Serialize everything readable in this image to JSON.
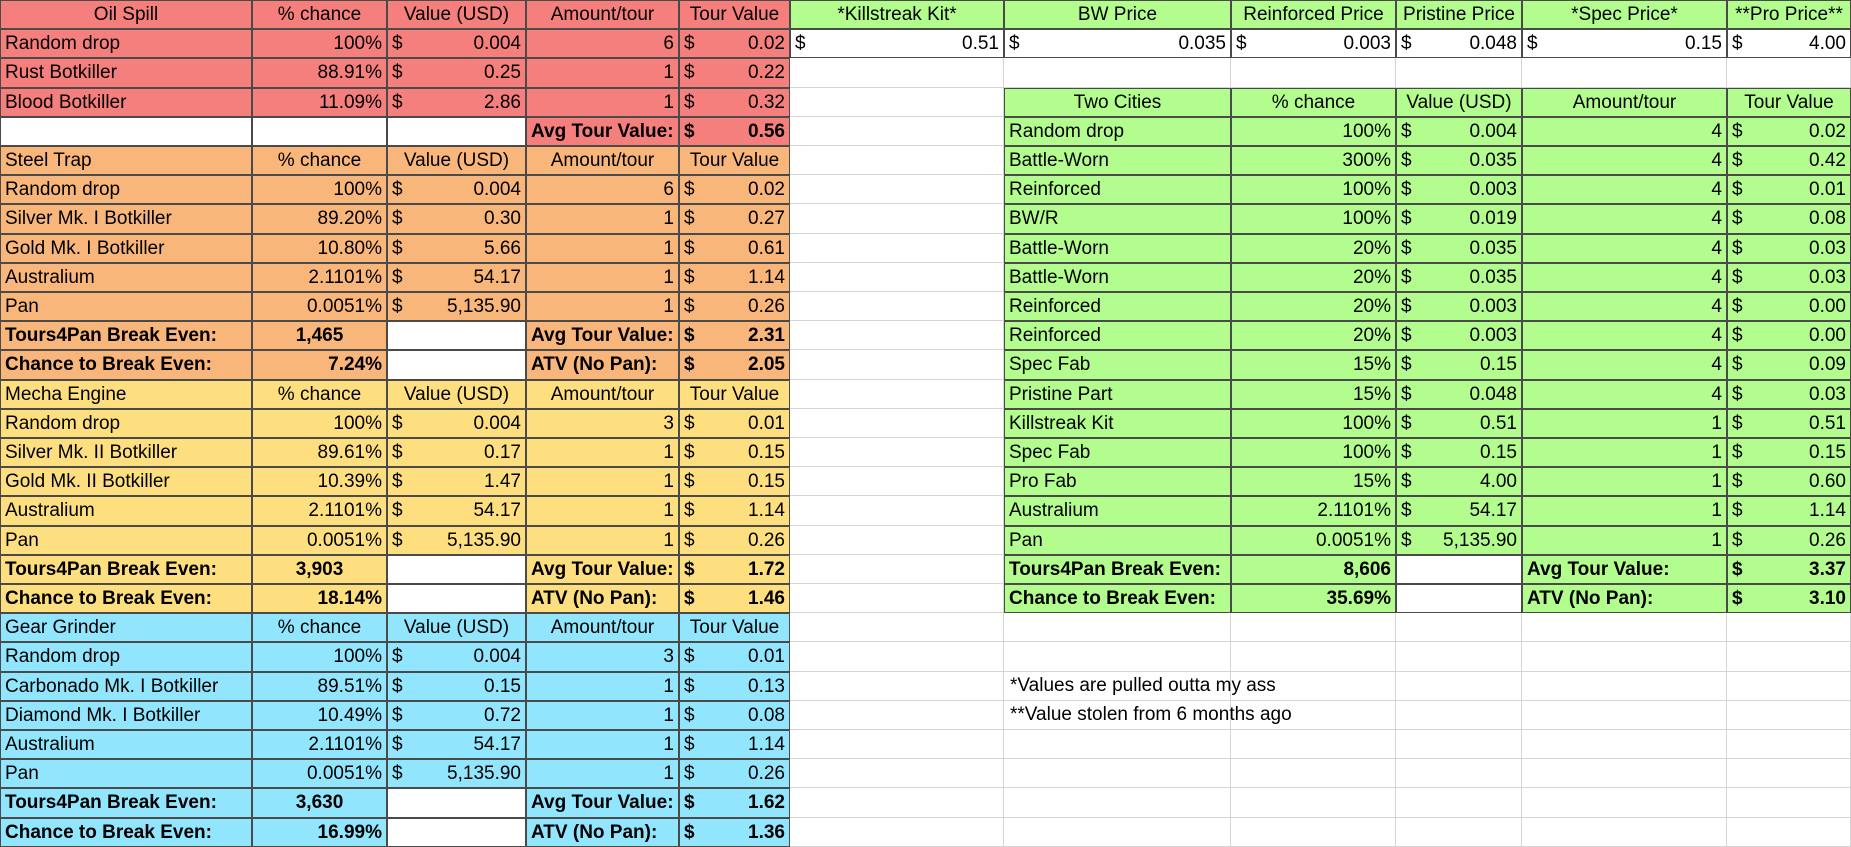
{
  "colors": {
    "red": "#f47f7c",
    "orange": "#f8b67a",
    "yellow": "#fedf7f",
    "cyan": "#91e5fc",
    "green": "#b2fd8e",
    "white": "#ffffff"
  },
  "currency": "$",
  "tables": [
    {
      "id": "oil-spill",
      "color": "red",
      "startRow": 0,
      "headers": [
        "Oil Spill",
        "% chance",
        "Value (USD)",
        "Amount/tour",
        "Tour Value"
      ],
      "rows": [
        [
          "Random drop",
          "100%",
          "0.004",
          "6",
          "0.02"
        ],
        [
          "Rust Botkiller",
          "88.91%",
          "0.25",
          "1",
          "0.22"
        ],
        [
          "Blood Botkiller",
          "11.09%",
          "2.86",
          "1",
          "0.32"
        ]
      ],
      "summary": [
        {
          "left_label": "",
          "left_value": "",
          "right_label": "Avg Tour Value:",
          "right_value": "0.56"
        }
      ]
    },
    {
      "id": "steel-trap",
      "color": "orange",
      "startRow": 5,
      "headers": [
        "Steel Trap",
        "% chance",
        "Value (USD)",
        "Amount/tour",
        "Tour Value"
      ],
      "rows": [
        [
          "Random drop",
          "100%",
          "0.004",
          "6",
          "0.02"
        ],
        [
          "Silver Mk. I Botkiller",
          "89.20%",
          "0.30",
          "1",
          "0.27"
        ],
        [
          "Gold Mk. I Botkiller",
          "10.80%",
          "5.66",
          "1",
          "0.61"
        ],
        [
          "Australium",
          "2.1101%",
          "54.17",
          "1",
          "1.14"
        ],
        [
          "Pan",
          "0.0051%",
          "5,135.90",
          "1",
          "0.26"
        ]
      ],
      "summary": [
        {
          "left_label": "Tours4Pan Break Even:",
          "left_value": "1,465",
          "right_label": "Avg Tour Value:",
          "right_value": "2.31"
        },
        {
          "left_label": "Chance to Break Even:",
          "left_value": "7.24%",
          "right_label": "ATV (No Pan):",
          "right_value": "2.05"
        }
      ]
    },
    {
      "id": "mecha-engine",
      "color": "yellow",
      "startRow": 13,
      "headers": [
        "Mecha Engine",
        "% chance",
        "Value (USD)",
        "Amount/tour",
        "Tour Value"
      ],
      "rows": [
        [
          "Random drop",
          "100%",
          "0.004",
          "3",
          "0.01"
        ],
        [
          "Silver Mk. II Botkiller",
          "89.61%",
          "0.17",
          "1",
          "0.15"
        ],
        [
          "Gold Mk. II Botkiller",
          "10.39%",
          "1.47",
          "1",
          "0.15"
        ],
        [
          "Australium",
          "2.1101%",
          "54.17",
          "1",
          "1.14"
        ],
        [
          "Pan",
          "0.0051%",
          "5,135.90",
          "1",
          "0.26"
        ]
      ],
      "summary": [
        {
          "left_label": "Tours4Pan Break Even:",
          "left_value": "3,903",
          "right_label": "Avg Tour Value:",
          "right_value": "1.72"
        },
        {
          "left_label": "Chance to Break Even:",
          "left_value": "18.14%",
          "right_label": "ATV (No Pan):",
          "right_value": "1.46"
        }
      ]
    },
    {
      "id": "gear-grinder",
      "color": "cyan",
      "startRow": 21,
      "headers": [
        "Gear Grinder",
        "% chance",
        "Value (USD)",
        "Amount/tour",
        "Tour Value"
      ],
      "rows": [
        [
          "Random drop",
          "100%",
          "0.004",
          "3",
          "0.01"
        ],
        [
          "Carbonado Mk. I Botkiller",
          "89.51%",
          "0.15",
          "1",
          "0.13"
        ],
        [
          "Diamond Mk. I Botkiller",
          "10.49%",
          "0.72",
          "1",
          "0.08"
        ],
        [
          "Australium",
          "2.1101%",
          "54.17",
          "1",
          "1.14"
        ],
        [
          "Pan",
          "0.0051%",
          "5,135.90",
          "1",
          "0.26"
        ]
      ],
      "summary": [
        {
          "left_label": "Tours4Pan Break Even:",
          "left_value": "3,630",
          "right_label": "Avg Tour Value:",
          "right_value": "1.62"
        },
        {
          "left_label": "Chance to Break Even:",
          "left_value": "16.99%",
          "right_label": "ATV (No Pan):",
          "right_value": "1.36"
        }
      ]
    }
  ],
  "prices": {
    "headers": [
      "*Killstreak Kit*",
      "BW Price",
      "Reinforced Price",
      "Pristine Price",
      "*Spec Price*",
      "**Pro Price**"
    ],
    "values": [
      "0.51",
      "0.035",
      "0.003",
      "0.048",
      "0.15",
      "4.00"
    ]
  },
  "two_cities": {
    "headers": [
      "Two Cities",
      "% chance",
      "Value (USD)",
      "Amount/tour",
      "Tour Value"
    ],
    "rows": [
      [
        "Random drop",
        "100%",
        "0.004",
        "4",
        "0.02"
      ],
      [
        "Battle-Worn",
        "300%",
        "0.035",
        "4",
        "0.42"
      ],
      [
        "Reinforced",
        "100%",
        "0.003",
        "4",
        "0.01"
      ],
      [
        "BW/R",
        "100%",
        "0.019",
        "4",
        "0.08"
      ],
      [
        "Battle-Worn",
        "20%",
        "0.035",
        "4",
        "0.03"
      ],
      [
        "Battle-Worn",
        "20%",
        "0.035",
        "4",
        "0.03"
      ],
      [
        "Reinforced",
        "20%",
        "0.003",
        "4",
        "0.00"
      ],
      [
        "Reinforced",
        "20%",
        "0.003",
        "4",
        "0.00"
      ],
      [
        "Spec Fab",
        "15%",
        "0.15",
        "4",
        "0.09"
      ],
      [
        "Pristine Part",
        "15%",
        "0.048",
        "4",
        "0.03"
      ],
      [
        "Killstreak Kit",
        "100%",
        "0.51",
        "1",
        "0.51"
      ],
      [
        "Spec Fab",
        "100%",
        "0.15",
        "1",
        "0.15"
      ],
      [
        "Pro Fab",
        "15%",
        "4.00",
        "1",
        "0.60"
      ],
      [
        "Australium",
        "2.1101%",
        "54.17",
        "1",
        "1.14"
      ],
      [
        "Pan",
        "0.0051%",
        "5,135.90",
        "1",
        "0.26"
      ]
    ],
    "summary": [
      {
        "left_label": "Tours4Pan Break Even:",
        "left_value": "8,606",
        "right_label": "Avg Tour Value:",
        "right_value": "3.37"
      },
      {
        "left_label": "Chance to Break Even:",
        "left_value": "35.69%",
        "right_label": "ATV (No Pan):",
        "right_value": "3.10"
      }
    ]
  },
  "notes": [
    "*Values are pulled outta my ass",
    "**Value stolen from 6 months ago"
  ]
}
